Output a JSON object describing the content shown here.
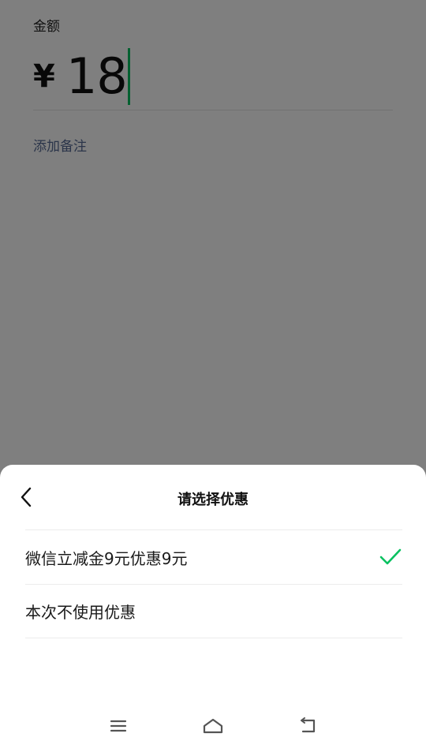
{
  "payment": {
    "amount_label": "金额",
    "currency_symbol": "¥",
    "amount_value": "18",
    "add_remark_link": "添加备注"
  },
  "discount_sheet": {
    "title": "请选择优惠",
    "options": [
      {
        "label": "微信立减金9元优惠9元",
        "selected": true
      },
      {
        "label": "本次不使用优惠",
        "selected": false
      }
    ]
  },
  "colors": {
    "accent_green": "#07c160",
    "link_blue": "#576b95"
  },
  "icons": {
    "back": "chevron-left-icon",
    "check": "checkmark-icon",
    "nav_menu": "menu-icon",
    "nav_home": "home-icon",
    "nav_back": "back-arrow-icon"
  }
}
